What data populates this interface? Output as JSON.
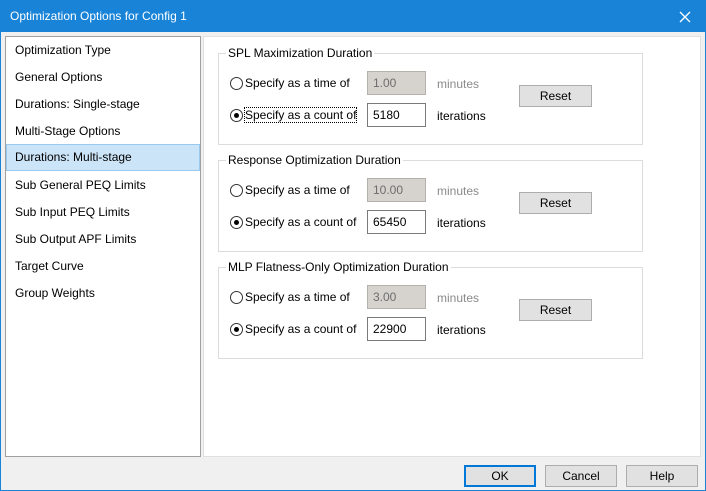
{
  "window": {
    "title": "Optimization Options for Config 1"
  },
  "nav": {
    "items": [
      {
        "label": "Optimization Type",
        "selected": false
      },
      {
        "label": "General Options",
        "selected": false
      },
      {
        "label": "Durations: Single-stage",
        "selected": false
      },
      {
        "label": "Multi-Stage Options",
        "selected": false
      },
      {
        "label": "Durations: Multi-stage",
        "selected": true
      },
      {
        "label": "Sub General PEQ Limits",
        "selected": false
      },
      {
        "label": "Sub Input PEQ Limits",
        "selected": false
      },
      {
        "label": "Sub Output APF Limits",
        "selected": false
      },
      {
        "label": "Target Curve",
        "selected": false
      },
      {
        "label": "Group Weights",
        "selected": false
      }
    ]
  },
  "groups": [
    {
      "title": "SPL Maximization Duration",
      "time_label": "Specify as a time of",
      "time_value": "1.00",
      "time_unit": "minutes",
      "count_label": "Specify as a count of",
      "count_value": "5180",
      "count_unit": "iterations",
      "selected": "count",
      "reset_label": "Reset"
    },
    {
      "title": "Response Optimization Duration",
      "time_label": "Specify as a time of",
      "time_value": "10.00",
      "time_unit": "minutes",
      "count_label": "Specify as a count of",
      "count_value": "65450",
      "count_unit": "iterations",
      "selected": "count",
      "reset_label": "Reset"
    },
    {
      "title": "MLP Flatness-Only Optimization Duration",
      "time_label": "Specify as a time of",
      "time_value": "3.00",
      "time_unit": "minutes",
      "count_label": "Specify as a count of",
      "count_value": "22900",
      "count_unit": "iterations",
      "selected": "count",
      "reset_label": "Reset"
    }
  ],
  "footer": {
    "ok_label": "OK",
    "cancel_label": "Cancel",
    "help_label": "Help"
  },
  "colors": {
    "titlebar": "#1883d7",
    "selection": "#cce4f7",
    "default_button_border": "#0078d7"
  }
}
